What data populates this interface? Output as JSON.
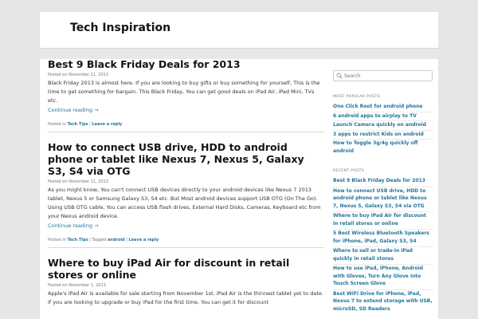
{
  "site": {
    "title": "Tech Inspiration"
  },
  "posts": [
    {
      "title": "Best 9 Black Friday Deals for 2013",
      "date": "Posted on November 21, 2013",
      "excerpt": "Black Friday 2013 is almost here. If you are looking to buy gifts or buy something for yourself, This is the time to get something for bargain. This Black Friday, You can get good deals on iPad Air, iPad Mini, TVs etc.",
      "continue": "Continue reading →",
      "meta_prefix": "Posted in ",
      "category": "Tech Tips",
      "sep": " | ",
      "reply": "Leave a reply"
    },
    {
      "title": "How to connect USB drive, HDD to android phone or tablet like Nexus 7, Nexus 5, Galaxy S3, S4 via OTG",
      "date": "Posted on November 11, 2013",
      "excerpt": "As you might know, You can't connect USB devices directly to your android devices like Nexus 7 2013 tablet, Nexus 5 or Samsung Galaxy S3, S4 etc. But Most android devices support USB OTG (On The Go). Using USB OTG cable, You can access USB flash drives, External Hard Disks, Cameras, Keyboard etc from your Nexus android device.",
      "continue": "Continue reading →",
      "meta_prefix": "Posted in ",
      "category": "Tech Tips",
      "tagged_prefix": " | Tagged ",
      "tag": "android",
      "sep": " | ",
      "reply": "Leave a reply"
    },
    {
      "title": "Where to buy iPad Air for discount in retail stores or online",
      "date": "Posted on November 1, 2013",
      "excerpt": "Apple's iPad Air is available for sale starting from November 1st. iPad Air is the thinnest tablet yet to date. If you are looking to upgrade or buy iPad for the first time, You can get it for discount"
    }
  ],
  "sidebar": {
    "search_placeholder": "Search",
    "popular_title": "MOST POPULAR POSTS",
    "popular": [
      "One Click Root for android phone",
      "6 android apps to airplay to TV",
      "Launch Camera quickly on android",
      "3 apps to restrict Kids on android",
      "How to Toggle 3g/4g quickly off android"
    ],
    "recent_title": "RECENT POSTS",
    "recent": [
      "Best 9 Black Friday Deals for 2013",
      "How to connect USB drive, HDD to android phone or tablet like Nexus 7, Nexus 5, Galaxy S3, S4 via OTG",
      "Where to buy iPad Air for discount in retail stores or online",
      "5 Best Wireless Bluetooth Speakers for iPhone, iPad, Galaxy S3, S4",
      "Where to sell or trade-in iPad quickly in retail stores",
      "How to use iPad, iPhone, Android with Gloves, Turn Any Glove into Touch Screen Glove",
      "Best WiFi Drive for iPhone, iPad, Nexus 7 to extend storage with USB, microSD, SD Readers"
    ]
  }
}
